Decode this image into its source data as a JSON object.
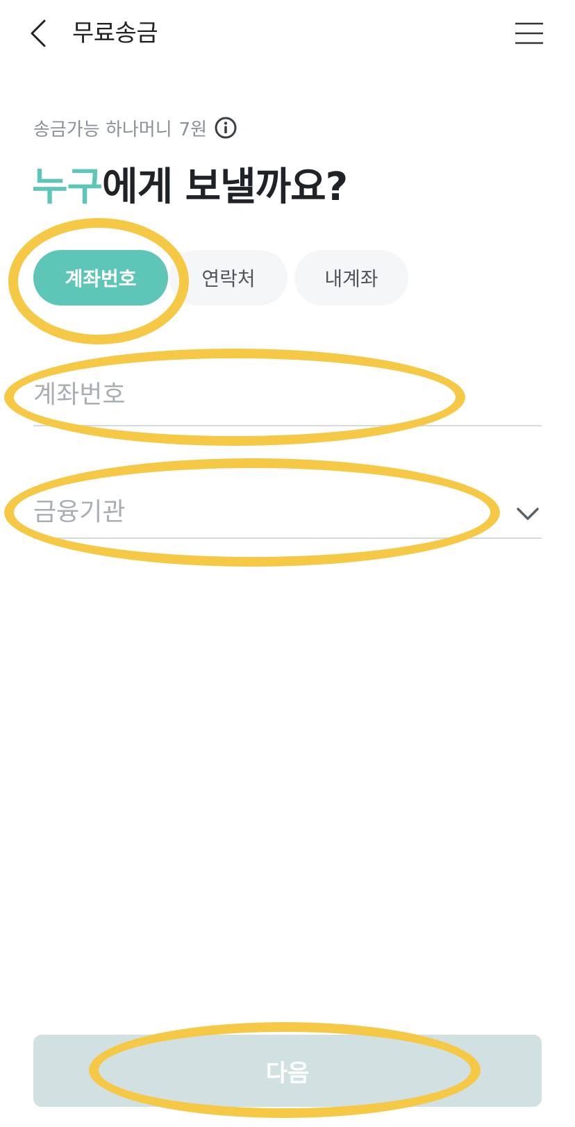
{
  "header": {
    "title": "무료송금"
  },
  "balance": {
    "label": "송금가능 하나머니",
    "amount": "7원"
  },
  "question": {
    "accent": "누구",
    "rest": "에게 보낼까요?"
  },
  "tabs": [
    {
      "label": "계좌번호",
      "active": true
    },
    {
      "label": "연락처",
      "active": false
    },
    {
      "label": "내계좌",
      "active": false
    }
  ],
  "account_field": {
    "placeholder": "계좌번호",
    "value": ""
  },
  "bank_select": {
    "placeholder": "금융기관"
  },
  "next_button": {
    "label": "다음"
  },
  "colors": {
    "accent": "#5ec6b6",
    "highlight": "#f5c845",
    "next_button_bg": "#d1e1e1"
  },
  "icons": [
    "chevron-left-icon",
    "hamburger-menu-icon",
    "info-icon",
    "chevron-down-icon"
  ]
}
